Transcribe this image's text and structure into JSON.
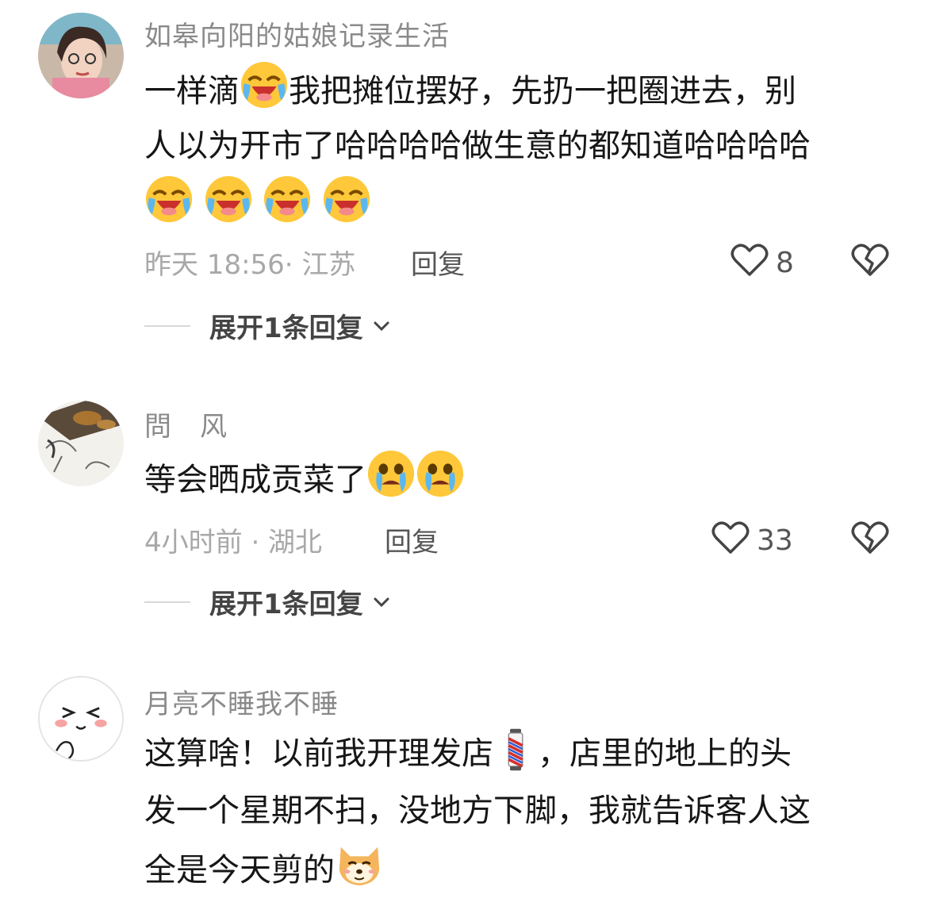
{
  "comments": [
    {
      "username": "如皋向阳的姑娘记录生活",
      "text_lines": [
        "一样滴",
        "我把摊位摆好，先扔一把圈进去，别",
        "人以为开市了哈哈哈哈做生意的都知道哈哈哈哈"
      ],
      "emojis": [
        "laughing-crying-emoji",
        "laughing-crying-emoji",
        "laughing-crying-emoji",
        "laughing-crying-emoji",
        "laughing-crying-emoji"
      ],
      "meta": "昨天 18:56· 江苏",
      "reply_label": "回复",
      "likes": "8",
      "expand_label": "展开1条回复"
    },
    {
      "username": "問　风",
      "text_lines": [
        "等会晒成贡菜了"
      ],
      "emojis": [
        "crying-emoji",
        "crying-emoji"
      ],
      "meta": "4小时前 · 湖北",
      "reply_label": "回复",
      "likes": "33",
      "expand_label": "展开1条回复"
    },
    {
      "username": "月亮不睡我不睡",
      "text_lines": [
        "这算啥！以前我开理发店",
        "，店里的地上的头",
        "发一个星期不扫，没地方下脚，我就告诉客人这",
        "全是今天剪的"
      ],
      "emojis": [
        "barber-pole-emoji",
        "doge-emoji"
      ]
    }
  ],
  "colors": {
    "username": "#8a8a8a",
    "text": "#161616",
    "meta": "#a8a8a8",
    "emoji_yellow": "#ffc83a"
  }
}
